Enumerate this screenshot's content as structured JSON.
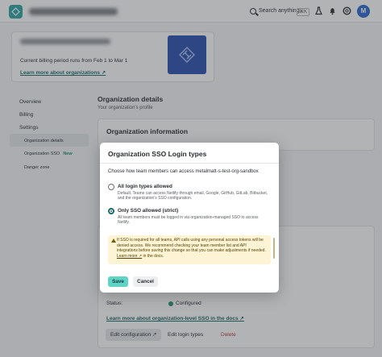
{
  "topbar": {
    "search_placeholder": "Search anything",
    "search_shortcut": "⌘K",
    "avatar_initial": "M"
  },
  "billing": {
    "period_text": "Current billing period runs from Feb 1 to Mar 1",
    "learn_more": "Learn more about organizations ↗"
  },
  "sidebar": {
    "items": [
      {
        "label": "Overview"
      },
      {
        "label": "Billing"
      },
      {
        "label": "Settings"
      }
    ],
    "sub_items": [
      {
        "label": "Organization details"
      },
      {
        "label": "Organization SSO",
        "badge": "New"
      },
      {
        "label": "Danger zone"
      }
    ]
  },
  "main": {
    "title": "Organization details",
    "subtitle": "Your organization's profile",
    "info_card_title": "Organization information",
    "sso_card": {
      "status_label": "Status:",
      "status_value": "Configured",
      "docs_link": "Learn more about organization-level SSO in the docs ↗",
      "edit_config": "Edit configuration ↗",
      "edit_login_types": "Edit login types",
      "delete": "Delete"
    }
  },
  "modal": {
    "title": "Organization SSO Login types",
    "description": "Choose how team members can access metalmatt-s-test-org-sandbox",
    "options": [
      {
        "title": "All login types allowed",
        "description": "Default. Teams can access Netlify through email, Google, GitHub, GitLab, Bitbucket, and the organization's SSO configuration.",
        "checked": false
      },
      {
        "title": "Only SSO allowed (strict)",
        "description": "All team members must be logged in via organization-managed SSO to access Netlify.",
        "checked": true
      }
    ],
    "warning": {
      "text": "If SSO is required for all teams, API calls using any personal access tokens will be denied access. We recommend checking your team member list and API integrations before saving this change so that you can make adjustments if needed.",
      "link": "Learn more ↗",
      "suffix": "in the docs."
    },
    "save_label": "Save",
    "cancel_label": "Cancel"
  }
}
